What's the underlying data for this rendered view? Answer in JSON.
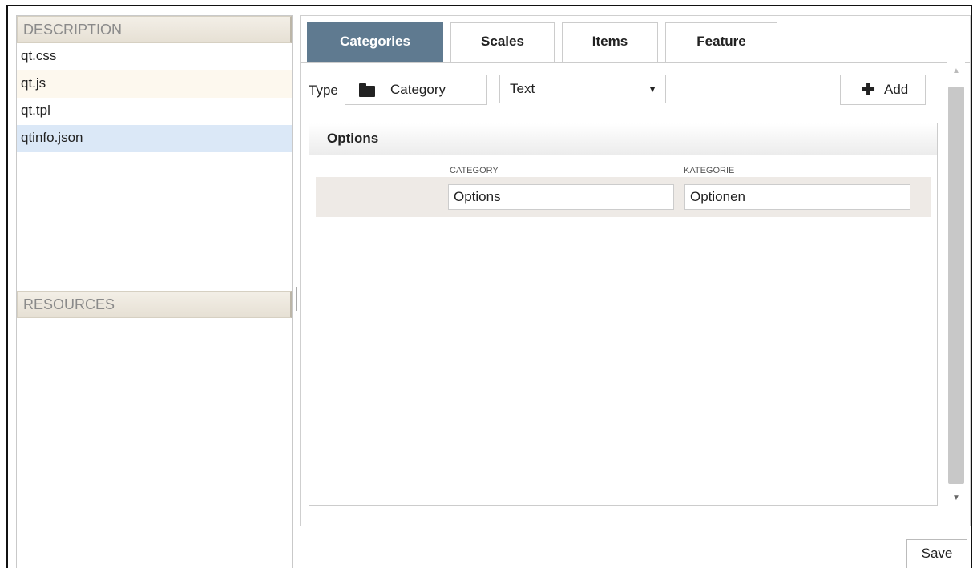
{
  "left_panel": {
    "description_header": "DESCRIPTION",
    "files": [
      "qt.css",
      "qt.js",
      "qt.tpl",
      "qtinfo.json"
    ],
    "resources_header": "RESOURCES"
  },
  "tabs": [
    "Categories",
    "Scales",
    "Items",
    "Feature"
  ],
  "toolbar": {
    "type_label": "Type",
    "category_button": "Category",
    "select_value": "Text",
    "select_arrow": "▼",
    "add_plus": "✚",
    "add_label": "Add"
  },
  "options": {
    "title": "Options",
    "columns": [
      "CATEGORY",
      "KATEGORIE"
    ],
    "row": [
      "Options",
      "Optionen"
    ]
  },
  "scrollbar": {
    "up": "▲",
    "down": "▼"
  },
  "save_label": "Save"
}
